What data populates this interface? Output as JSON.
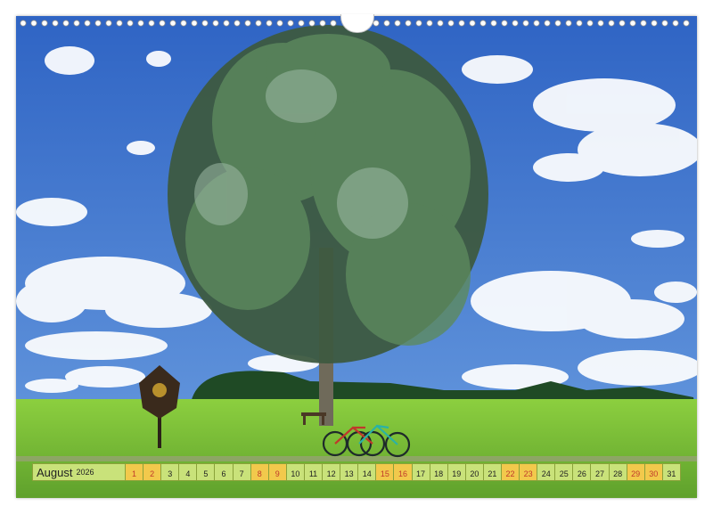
{
  "calendar": {
    "month": "August",
    "year": "2026",
    "days": [
      {
        "n": "1",
        "weekend": true
      },
      {
        "n": "2",
        "weekend": true
      },
      {
        "n": "3",
        "weekend": false
      },
      {
        "n": "4",
        "weekend": false
      },
      {
        "n": "5",
        "weekend": false
      },
      {
        "n": "6",
        "weekend": false
      },
      {
        "n": "7",
        "weekend": false
      },
      {
        "n": "8",
        "weekend": true
      },
      {
        "n": "9",
        "weekend": true
      },
      {
        "n": "10",
        "weekend": false
      },
      {
        "n": "11",
        "weekend": false
      },
      {
        "n": "12",
        "weekend": false
      },
      {
        "n": "13",
        "weekend": false
      },
      {
        "n": "14",
        "weekend": false
      },
      {
        "n": "15",
        "weekend": true
      },
      {
        "n": "16",
        "weekend": true
      },
      {
        "n": "17",
        "weekend": false
      },
      {
        "n": "18",
        "weekend": false
      },
      {
        "n": "19",
        "weekend": false
      },
      {
        "n": "20",
        "weekend": false
      },
      {
        "n": "21",
        "weekend": false
      },
      {
        "n": "22",
        "weekend": true
      },
      {
        "n": "23",
        "weekend": true
      },
      {
        "n": "24",
        "weekend": false
      },
      {
        "n": "25",
        "weekend": false
      },
      {
        "n": "26",
        "weekend": false
      },
      {
        "n": "27",
        "weekend": false
      },
      {
        "n": "28",
        "weekend": false
      },
      {
        "n": "29",
        "weekend": true
      },
      {
        "n": "30",
        "weekend": true
      },
      {
        "n": "31",
        "weekend": false
      }
    ]
  },
  "colors": {
    "sky": "#3f78cf",
    "grass": "#7fbf3a",
    "bar": "#c9e27a",
    "weekend": "#f2c94c",
    "weekend_text": "#c0392b"
  }
}
